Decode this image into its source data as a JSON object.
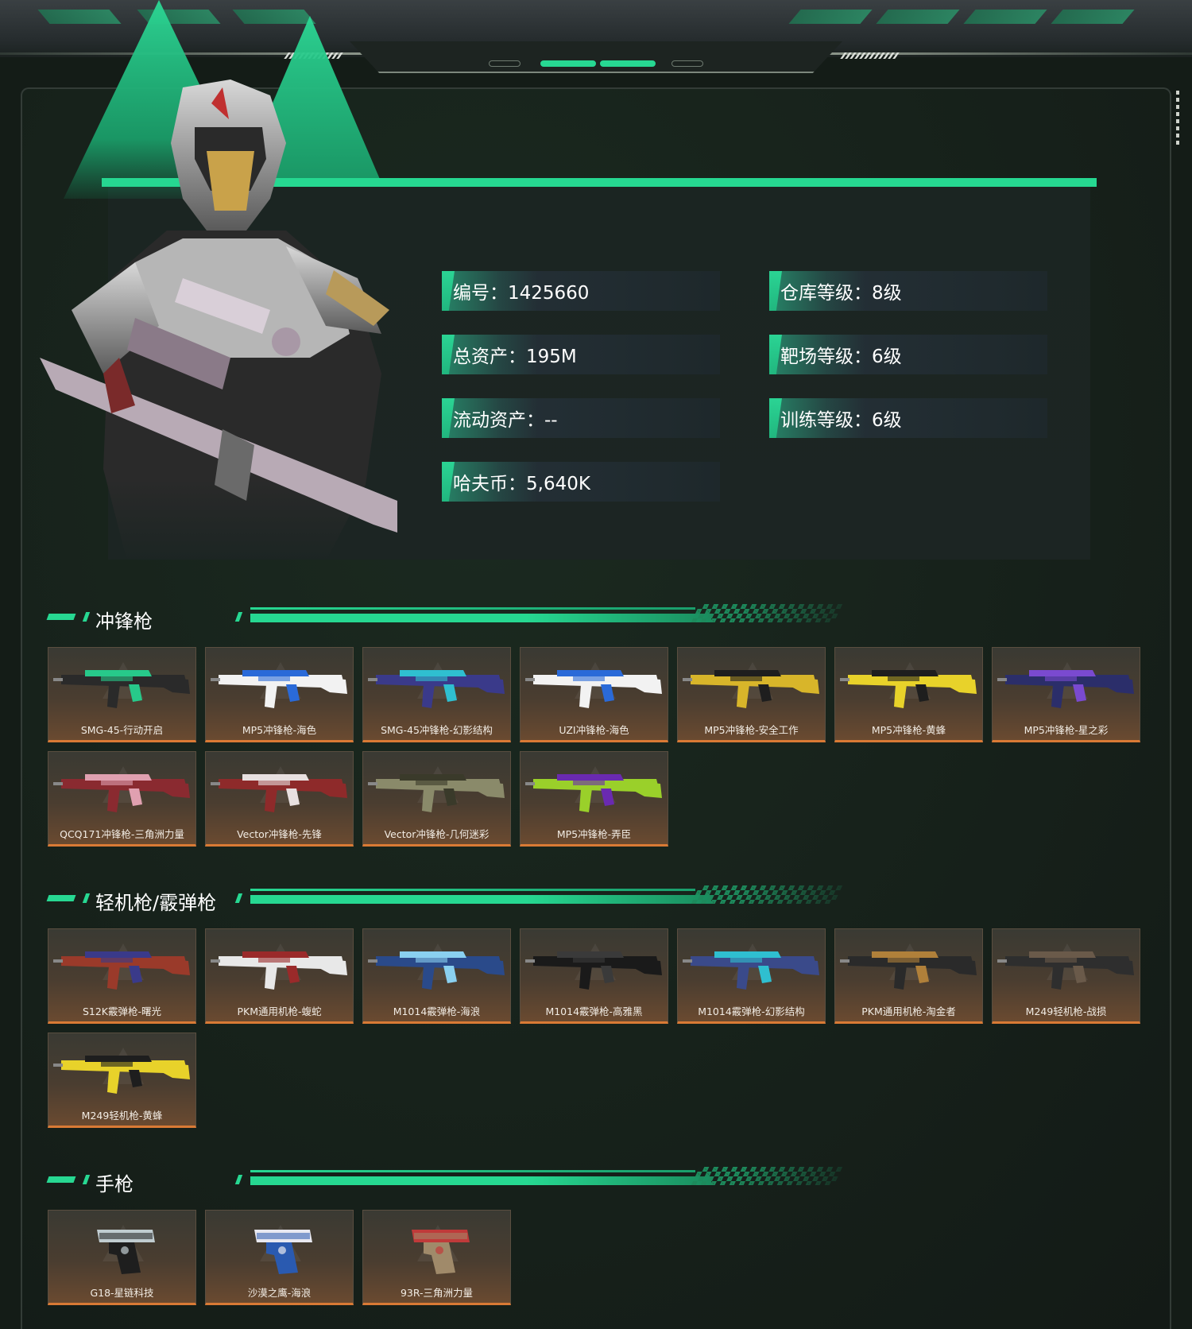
{
  "player": {
    "stats_left": [
      {
        "label": "编号",
        "value": "1425660",
        "text": "编号：1425660"
      },
      {
        "label": "总资产",
        "value": "195M",
        "text": "总资产：195M"
      },
      {
        "label": "流动资产",
        "value": "--",
        "text": "流动资产：--"
      },
      {
        "label": "哈夫币",
        "value": "5,640K",
        "text": "哈夫币：5,640K"
      }
    ],
    "stats_right": [
      {
        "label": "仓库等级",
        "value": "8级",
        "text": "仓库等级：8级"
      },
      {
        "label": "靶场等级",
        "value": "6级",
        "text": "靶场等级：6级"
      },
      {
        "label": "训练等级",
        "value": "6级",
        "text": "训练等级：6级"
      }
    ]
  },
  "sections": [
    {
      "title": "冲锋枪",
      "items": [
        {
          "name": "SMG-45-行动开启",
          "colors": [
            "#2a2a2a",
            "#27c98a"
          ]
        },
        {
          "name": "MP5冲锋枪-海色",
          "colors": [
            "#f2f2f2",
            "#2a6ad8"
          ]
        },
        {
          "name": "SMG-45冲锋枪-幻影结构",
          "colors": [
            "#3a3a8a",
            "#2fbfd0"
          ]
        },
        {
          "name": "UZI冲锋枪-海色",
          "colors": [
            "#f2f2f2",
            "#2a6ad8"
          ]
        },
        {
          "name": "MP5冲锋枪-安全工作",
          "colors": [
            "#d8b52a",
            "#1e1e1e"
          ]
        },
        {
          "name": "MP5冲锋枪-黄蜂",
          "colors": [
            "#e8d22a",
            "#1e1e1e"
          ]
        },
        {
          "name": "MP5冲锋枪-星之彩",
          "colors": [
            "#2b2e6a",
            "#7a4ad0"
          ]
        },
        {
          "name": "QCQ171冲锋枪-三角洲力量",
          "colors": [
            "#8a2a30",
            "#e0a0b0"
          ]
        },
        {
          "name": "Vector冲锋枪-先锋",
          "colors": [
            "#8e2a2a",
            "#e8e0e0"
          ]
        },
        {
          "name": "Vector冲锋枪-几何迷彩",
          "colors": [
            "#8a8a6a",
            "#3a3a2a"
          ]
        },
        {
          "name": "MP5冲锋枪-弄臣",
          "colors": [
            "#9ad02a",
            "#6a2ab0"
          ]
        }
      ]
    },
    {
      "title": "轻机枪/霰弹枪",
      "items": [
        {
          "name": "S12K霰弹枪-曙光",
          "colors": [
            "#9a3a2a",
            "#3a3a8a"
          ]
        },
        {
          "name": "PKM通用机枪-蝮蛇",
          "colors": [
            "#e8e8e8",
            "#9a2a2a"
          ]
        },
        {
          "name": "M1014霰弹枪-海浪",
          "colors": [
            "#2a4a8a",
            "#8ad0f0"
          ]
        },
        {
          "name": "M1014霰弹枪-高雅黑",
          "colors": [
            "#1a1a1a",
            "#3a3a3a"
          ]
        },
        {
          "name": "M1014霰弹枪-幻影结构",
          "colors": [
            "#3a4a8a",
            "#2fbfd0"
          ]
        },
        {
          "name": "PKM通用机枪-淘金者",
          "colors": [
            "#2a2a2a",
            "#b0803a"
          ]
        },
        {
          "name": "M249轻机枪-战损",
          "colors": [
            "#2e2e2e",
            "#6a5a4a"
          ]
        },
        {
          "name": "M249轻机枪-黄蜂",
          "colors": [
            "#e8d22a",
            "#1e1e1e"
          ]
        }
      ]
    },
    {
      "title": "手枪",
      "items": [
        {
          "name": "G18-星链科技",
          "colors": [
            "#1e1e1e",
            "#c0ccd0"
          ]
        },
        {
          "name": "沙漠之鹰-海浪",
          "colors": [
            "#2a5ab0",
            "#e8e8f0"
          ]
        },
        {
          "name": "93R-三角洲力量",
          "colors": [
            "#a08a6a",
            "#c03a3a"
          ]
        }
      ]
    }
  ],
  "colors": {
    "accent": "#26d891",
    "card_border": "#d97a35",
    "background": "#141c17"
  }
}
